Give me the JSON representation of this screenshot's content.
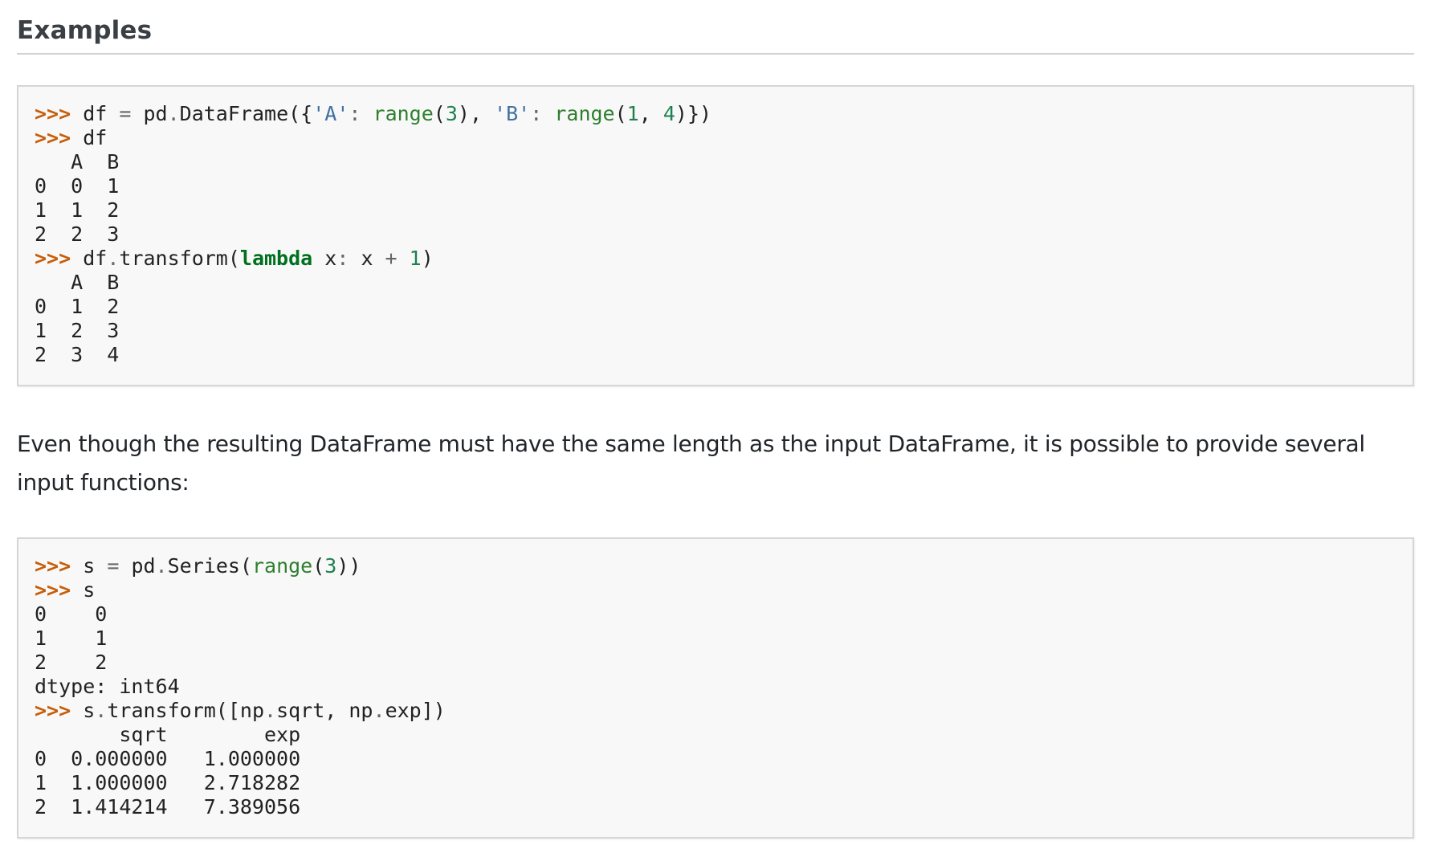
{
  "section": {
    "title": "Examples"
  },
  "examples": [
    {
      "lines": [
        ">>> df = pd.DataFrame({'A': range(3), 'B': range(1, 4)})",
        ">>> df",
        "   A  B",
        "0  0  1",
        "1  1  2",
        "2  2  3",
        ">>> df.transform(lambda x: x + 1)",
        "   A  B",
        "0  1  2",
        "1  2  3",
        "2  3  4"
      ]
    },
    {
      "lines": [
        ">>> s = pd.Series(range(3))",
        ">>> s",
        "0    0",
        "1    1",
        "2    2",
        "dtype: int64",
        ">>> s.transform([np.sqrt, np.exp])",
        "       sqrt        exp",
        "0  0.000000   1.000000",
        "1  1.000000   2.718282",
        "2  1.414214   7.389056"
      ]
    }
  ],
  "paragraph": {
    "text": "Even though the resulting DataFrame must have the same length as the input DataFrame, it is possible to provide several input functions:"
  },
  "colors": {
    "prompt": "#c65d09",
    "builtin": "#2f7f2f",
    "string": "#4070a0",
    "number": "#208050",
    "keyword": "#007020",
    "code_background": "#f8f8f8"
  }
}
